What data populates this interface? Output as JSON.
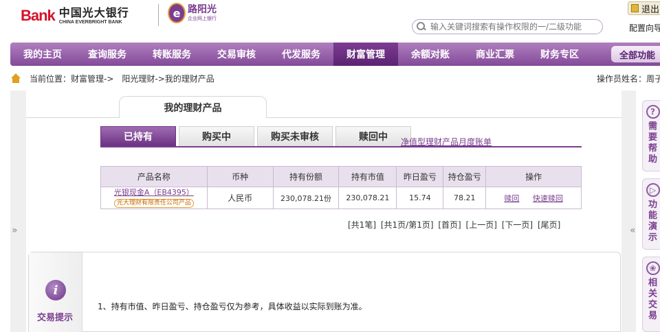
{
  "header": {
    "logo_text": "Bank",
    "bank_name_cn": "中国光大银行",
    "bank_name_en": "CHINA EVERBRIGHT BANK",
    "sub_logo_title": "路阳光",
    "sub_logo_caption": "企业网上银行",
    "search_placeholder": "输入关键词搜索有操作权限的一/二级功能",
    "exit_label": "退出",
    "config_label": "配置向导"
  },
  "nav": {
    "items": [
      "我的主页",
      "查询服务",
      "转账服务",
      "交易审核",
      "代发服务",
      "财富管理",
      "余额对账",
      "商业汇票",
      "财务专区"
    ],
    "active_index": 5,
    "all_label": "全部功能"
  },
  "breadcrumb": {
    "prefix": "当前位置：",
    "items": [
      "财富管理->",
      "阳光理财->我的理财产品"
    ],
    "operator": "操作员姓名：周子"
  },
  "panel": {
    "title": "我的理财产品",
    "tabs": [
      "已持有",
      "购买中",
      "购买未审核",
      "赎回中"
    ],
    "active_tab": 0,
    "statement_link": "净值型理财产品月度账单"
  },
  "table": {
    "headers": [
      "产品名称",
      "币种",
      "持有份额",
      "持有市值",
      "昨日盈亏",
      "持仓盈亏",
      "操作"
    ],
    "rows": [
      {
        "product": "光银现金A（EB4395）",
        "issuer_badge": "光大理财有限责任公司产品",
        "currency": "人民币",
        "shares": "230,078.21份",
        "market_value": "230,078.21",
        "yesterday_pl": "15.74",
        "position_pl": "78.21",
        "actions": [
          "赎回",
          "快速赎回"
        ]
      }
    ]
  },
  "pager": [
    "[共1笔]",
    "[共1页/第1页]",
    "[首页]",
    "[上一页]",
    "[下一页]",
    "[尾页]"
  ],
  "tips": {
    "label": "交易提示",
    "icon": "i",
    "text": "1、持有市值、昨日盈亏、持仓盈亏仅为参考，具体收益以实际到账为准。"
  },
  "side_arrows": {
    "left": "»",
    "right": "«"
  },
  "right_panel": [
    {
      "icon": "?",
      "icon_name": "help-icon",
      "label": "需要帮助"
    },
    {
      "icon": "▷",
      "icon_name": "play-icon",
      "label": "功能演示"
    },
    {
      "icon": "❀",
      "icon_name": "related-icon",
      "label": "相关交易"
    }
  ],
  "colors": {
    "brand_purple": "#834a99",
    "active_purple": "#5a2370",
    "link_purple": "#7a3d8f",
    "bank_red": "#d4122a"
  }
}
